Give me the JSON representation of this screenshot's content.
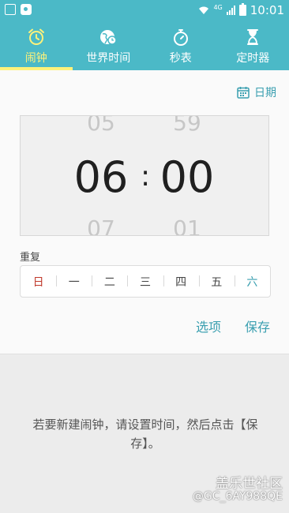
{
  "status_bar": {
    "network": "4G",
    "time": "10:01"
  },
  "tabs": [
    {
      "label": "闹钟",
      "icon": "alarm-clock-icon",
      "active": true
    },
    {
      "label": "世界时间",
      "icon": "world-clock-icon",
      "active": false
    },
    {
      "label": "秒表",
      "icon": "stopwatch-icon",
      "active": false
    },
    {
      "label": "定时器",
      "icon": "hourglass-icon",
      "active": false
    }
  ],
  "date_button": {
    "label": "日期",
    "icon": "calendar-icon"
  },
  "time_picker": {
    "hour_prev": "05",
    "hour": "06",
    "hour_next": "07",
    "separator": ":",
    "minute_prev": "59",
    "minute": "00",
    "minute_next": "01"
  },
  "repeat": {
    "label": "重复",
    "days": [
      "日",
      "一",
      "二",
      "三",
      "四",
      "五",
      "六"
    ]
  },
  "actions": {
    "options_label": "选项",
    "save_label": "保存"
  },
  "hint_text": "若要新建闹钟，请设置时间，然后点击【保存】。",
  "watermark": {
    "logo_text": "盖乐世社区",
    "user_id": "@GC_6AY988QE"
  },
  "colors": {
    "header": "#4bb9c7",
    "active_tab": "#fff27a",
    "accent": "#3a9fb0",
    "sunday": "#c0392b"
  }
}
